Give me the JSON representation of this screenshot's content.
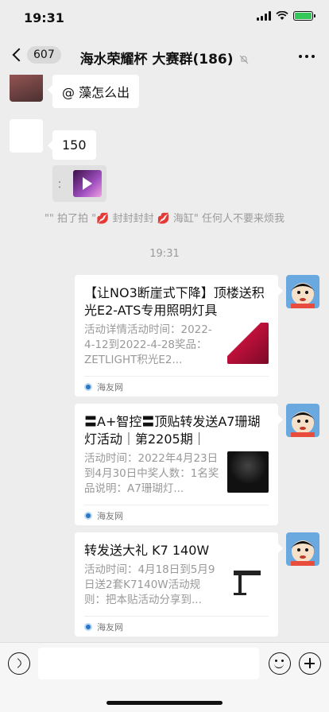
{
  "status": {
    "time": "19:31"
  },
  "nav": {
    "unread_count": "607",
    "title": "海水荣耀杯 大赛群(186)"
  },
  "messages": {
    "msg1_text": "@ 藻怎么出",
    "msg2_text": "150",
    "quote_prefix": "：",
    "system_pat": "\"\" 拍了拍 \"💋 封封封封 💋 海缸\" 任何人不要来烦我",
    "timestamp": "19:31"
  },
  "cards": [
    {
      "title": "【让NO3断崖式下降】顶楼送积光E2-ATS专用照明灯具",
      "desc": "活动详情活动时间：2022-4-12到2022-4-28奖品：ZETLIGHT积光E2...",
      "source": "海友网",
      "thumb_icon": "e2-lamp-product-image"
    },
    {
      "title": "〓A+智控〓顶贴转发送A7珊瑚灯活动｜第2205期｜",
      "desc": "活动时间：2022年4月23日到4月30日中奖人数：1名奖品说明：A7珊瑚灯...",
      "source": "海友网",
      "thumb_icon": "a7-coral-lamp-image"
    },
    {
      "title": "转发送大礼 K7 140W",
      "desc": "活动时间：4月18日到5月9日送2套K7140W活动规则：把本贴活动分享到...",
      "source": "海友网",
      "thumb_icon": "k7-lamp-image"
    }
  ],
  "colors": {
    "background": "#ededed",
    "bubble": "#ffffff",
    "battery": "#34c759"
  }
}
